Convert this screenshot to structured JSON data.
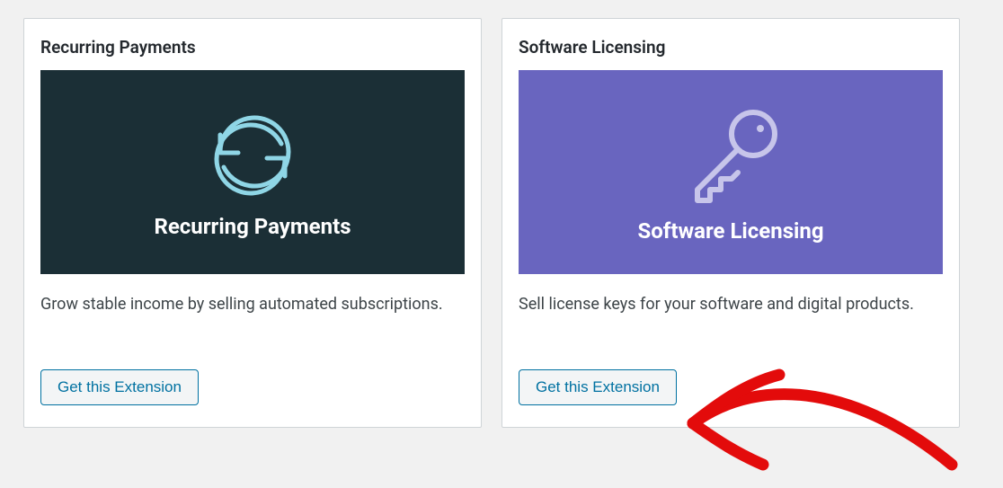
{
  "cards": [
    {
      "title": "Recurring Payments",
      "hero_label": "Recurring Payments",
      "description": "Grow stable income by selling automated subscriptions.",
      "button_label": "Get this Extension"
    },
    {
      "title": "Software Licensing",
      "hero_label": "Software Licensing",
      "description": "Sell license keys for your software and digital products.",
      "button_label": "Get this Extension"
    }
  ]
}
